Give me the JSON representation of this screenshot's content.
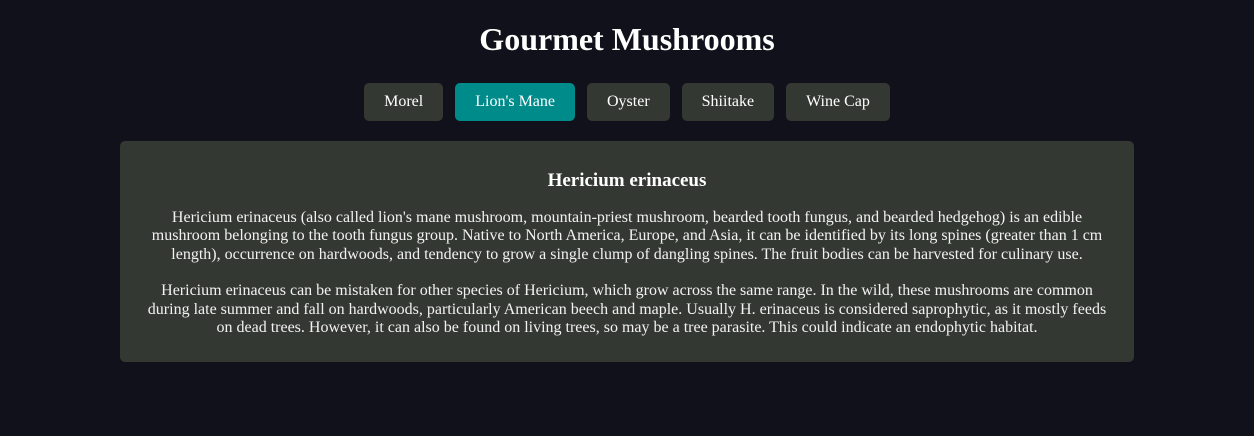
{
  "page": {
    "title": "Gourmet Mushrooms"
  },
  "tabs": [
    {
      "label": "Morel",
      "active": false
    },
    {
      "label": "Lion's Mane",
      "active": true
    },
    {
      "label": "Oyster",
      "active": false
    },
    {
      "label": "Shiitake",
      "active": false
    },
    {
      "label": "Wine Cap",
      "active": false
    }
  ],
  "panel": {
    "heading": "Hericium erinaceus",
    "paragraphs": [
      "Hericium erinaceus (also called lion's mane mushroom, mountain-priest mushroom, bearded tooth fungus, and bearded hedgehog) is an edible mushroom belonging to the tooth fungus group. Native to North America, Europe, and Asia, it can be identified by its long spines (greater than 1 cm length), occurrence on hardwoods, and tendency to grow a single clump of dangling spines. The fruit bodies can be harvested for culinary use.",
      "Hericium erinaceus can be mistaken for other species of Hericium, which grow across the same range. In the wild, these mushrooms are common during late summer and fall on hardwoods, particularly American beech and maple. Usually H. erinaceus is considered saprophytic, as it mostly feeds on dead trees. However, it can also be found on living trees, so may be a tree parasite. This could indicate an endophytic habitat."
    ]
  },
  "colors": {
    "background": "#10111a",
    "tab_background": "#343832",
    "tab_active": "#008b8b",
    "panel_background": "#343832",
    "text": "#ffffff"
  }
}
